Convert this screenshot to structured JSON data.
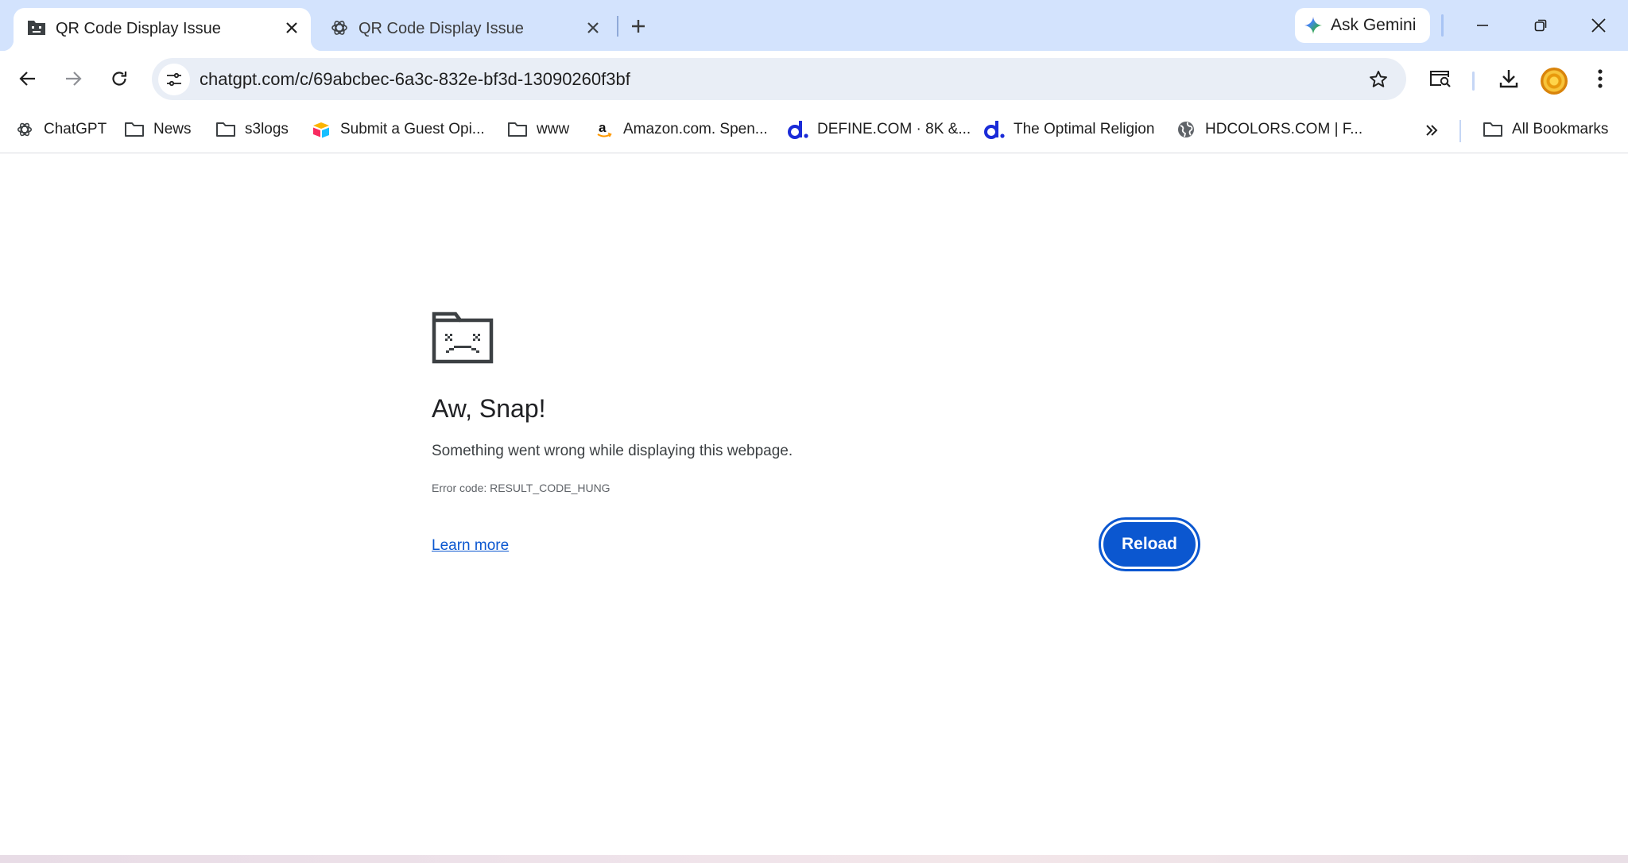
{
  "tabs": [
    {
      "title": "QR Code Display Issue",
      "favicon": "sad-folder-icon",
      "active": true
    },
    {
      "title": "QR Code Display Issue",
      "favicon": "chatgpt-icon",
      "active": false
    }
  ],
  "gemini": {
    "label": "Ask Gemini"
  },
  "omnibox": {
    "url": "chatgpt.com/c/69abcbec-6a3c-832e-bf3d-13090260f3bf"
  },
  "bookmarks": [
    {
      "label": "ChatGPT",
      "icon": "chatgpt-icon"
    },
    {
      "label": "News",
      "icon": "folder-icon"
    },
    {
      "label": "s3logs",
      "icon": "folder-icon"
    },
    {
      "label": "Submit a Guest Opi...",
      "icon": "airtable-icon"
    },
    {
      "label": "www",
      "icon": "folder-icon"
    },
    {
      "label": "Amazon.com. Spen...",
      "icon": "amazon-icon"
    },
    {
      "label": "DEFINE.COM · 8K &...",
      "icon": "define-icon"
    },
    {
      "label": "The Optimal Religion",
      "icon": "define-icon"
    },
    {
      "label": "HDCOLORS.COM | F...",
      "icon": "globe-icon"
    }
  ],
  "all_bookmarks": {
    "label": "All Bookmarks"
  },
  "error_page": {
    "title": "Aw, Snap!",
    "message": "Something went wrong while displaying this webpage.",
    "error_code": "Error code: RESULT_CODE_HUNG",
    "learn_more": "Learn more",
    "reload": "Reload"
  },
  "colors": {
    "tab_strip": "#d3e3fd",
    "omnibox": "#e9eef6",
    "accent": "#0b57d0"
  }
}
